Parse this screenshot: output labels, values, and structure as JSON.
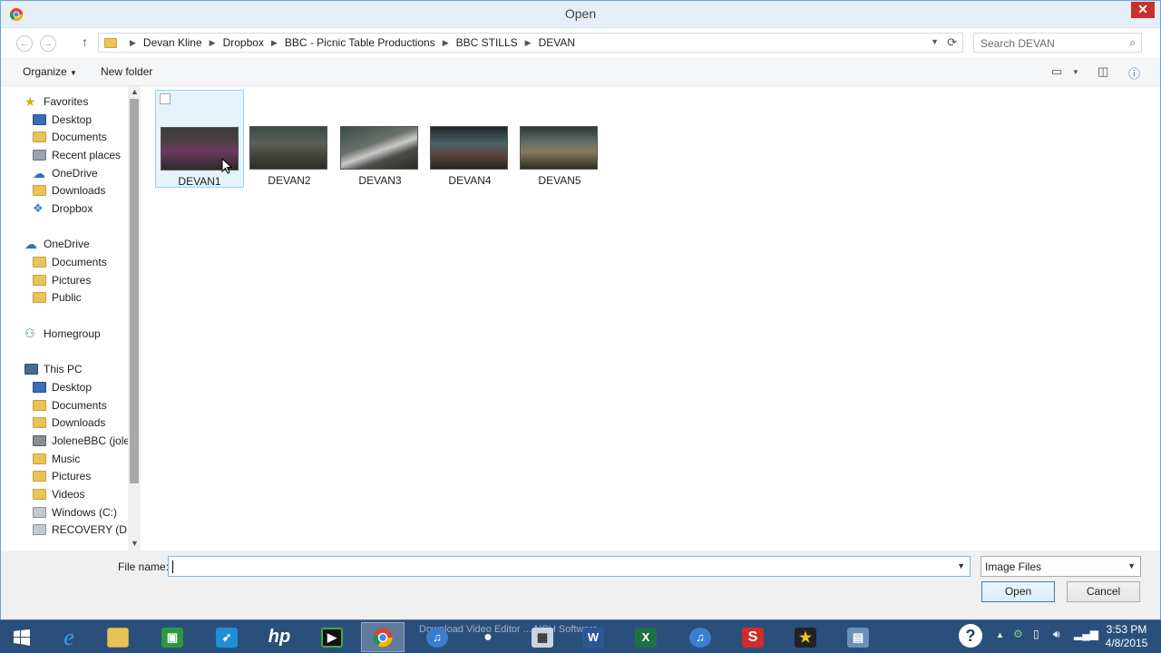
{
  "window": {
    "title": "Open",
    "close": "✕"
  },
  "address": {
    "back": "←",
    "forward": "→",
    "up": "↑",
    "breadcrumbs": [
      "Devan Kline",
      "Dropbox",
      "BBC - Picnic Table Productions",
      "BBC STILLS",
      "DEVAN"
    ],
    "search_placeholder": "Search DEVAN"
  },
  "toolbar": {
    "organize": "Organize",
    "new_folder": "New folder"
  },
  "nav": {
    "favorites": {
      "label": "Favorites",
      "items": [
        "Desktop",
        "Documents",
        "Recent places",
        "OneDrive",
        "Downloads",
        "Dropbox"
      ]
    },
    "onedrive": {
      "label": "OneDrive",
      "items": [
        "Documents",
        "Pictures",
        "Public"
      ]
    },
    "homegroup": {
      "label": "Homegroup"
    },
    "thispc": {
      "label": "This PC",
      "items": [
        "Desktop",
        "Documents",
        "Downloads",
        "JoleneBBC (jolen",
        "Music",
        "Pictures",
        "Videos",
        "Windows (C:)",
        "RECOVERY (D:)"
      ]
    }
  },
  "files": [
    {
      "name": "DEVAN1",
      "selected": true
    },
    {
      "name": "DEVAN2",
      "selected": false
    },
    {
      "name": "DEVAN3",
      "selected": false
    },
    {
      "name": "DEVAN4",
      "selected": false
    },
    {
      "name": "DEVAN5",
      "selected": false
    }
  ],
  "bottom": {
    "file_name_label": "File name:",
    "file_name_value": "",
    "filter_value": "Image Files",
    "open_button": "Open",
    "cancel_button": "Cancel"
  },
  "taskbar": {
    "ghost_text": "Download Video Editor ... NCH Software",
    "time": "3:53 PM",
    "date": "4/8/2015",
    "apps": [
      "start",
      "internet-explorer",
      "file-explorer",
      "store",
      "app-launcher",
      "hp",
      "video-capture",
      "chrome",
      "itunes",
      "webcam",
      "calculator",
      "word",
      "excel",
      "itunes-2",
      "s-app",
      "movie-maker-star",
      "video-editor"
    ]
  },
  "colors": {
    "accent": "#3c7fb1",
    "selection": "#e5f3fb",
    "taskbar": "#2a4f7a",
    "close": "#c7302b"
  }
}
